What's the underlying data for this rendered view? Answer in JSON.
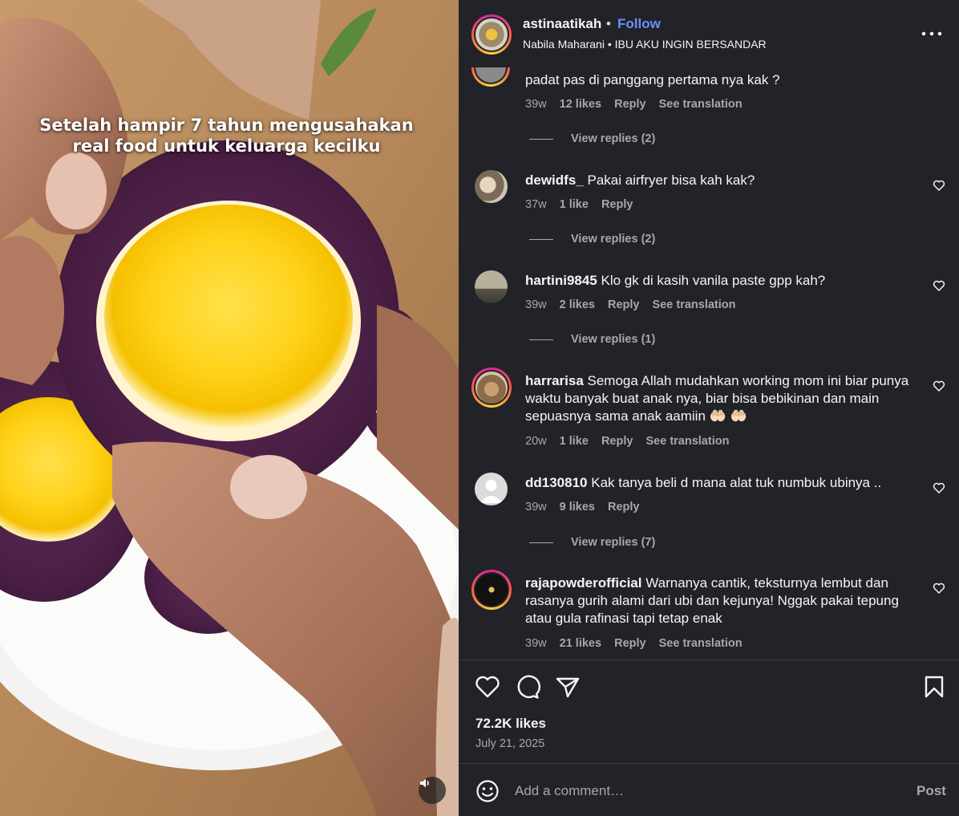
{
  "media": {
    "caption_lines": [
      "Setelah hampir 7 tahun mengusahakan",
      "real food untuk keluarga kecilku"
    ],
    "mute_icon": "speaker-icon"
  },
  "header": {
    "username": "astinaatikah",
    "separator": "•",
    "follow_label": "Follow",
    "audio_text": "Nabila Maharani • IBU AKU INGIN BERSANDAR",
    "more_icon": "more-horizontal-icon"
  },
  "comments": [
    {
      "username": "",
      "text": "padat pas di panggang pertama nya kak ?",
      "time": "39w",
      "likes": "12 likes",
      "reply": "Reply",
      "translate": "See translation",
      "view_replies": "View replies (2)"
    },
    {
      "username": "dewidfs_",
      "text": "Pakai airfryer bisa kah kak?",
      "time": "37w",
      "likes": "1 like",
      "reply": "Reply",
      "view_replies": "View replies (2)"
    },
    {
      "username": "hartini9845",
      "text": "Klo gk di kasih vanila paste gpp kah?",
      "time": "39w",
      "likes": "2 likes",
      "reply": "Reply",
      "translate": "See translation",
      "view_replies": "View replies (1)"
    },
    {
      "username": "harrarisa",
      "text": "Semoga Allah mudahkan working mom ini biar punya waktu banyak buat anak nya, biar bisa bebikinan dan main sepuasnya sama anak aamiin 🤲🏻 🤲🏻",
      "time": "20w",
      "likes": "1 like",
      "reply": "Reply",
      "translate": "See translation"
    },
    {
      "username": "dd130810",
      "text": "Kak tanya beli d mana alat tuk numbuk ubinya ..",
      "time": "39w",
      "likes": "9 likes",
      "reply": "Reply",
      "view_replies": "View replies (7)"
    },
    {
      "username": "rajapowderofficial",
      "text": "Warnanya cantik, teksturnya lembut dan rasanya gurih alami dari ubi dan kejunya! Nggak pakai tepung atau gula rafinasi tapi tetap enak",
      "time": "39w",
      "likes": "21 likes",
      "reply": "Reply",
      "translate": "See translation"
    }
  ],
  "actions": {
    "like_icon": "heart-icon",
    "comment_icon": "comment-icon",
    "share_icon": "send-icon",
    "save_icon": "bookmark-icon"
  },
  "stats": {
    "likes": "72.2K likes",
    "date": "July 21, 2025"
  },
  "composer": {
    "placeholder": "Add a comment…",
    "post_label": "Post",
    "emoji_icon": "smiley-icon"
  },
  "colors": {
    "panel_bg": "#212328",
    "follow": "#6f8dff",
    "muted": "#a8a8a8",
    "text": "#f5f5f5"
  }
}
